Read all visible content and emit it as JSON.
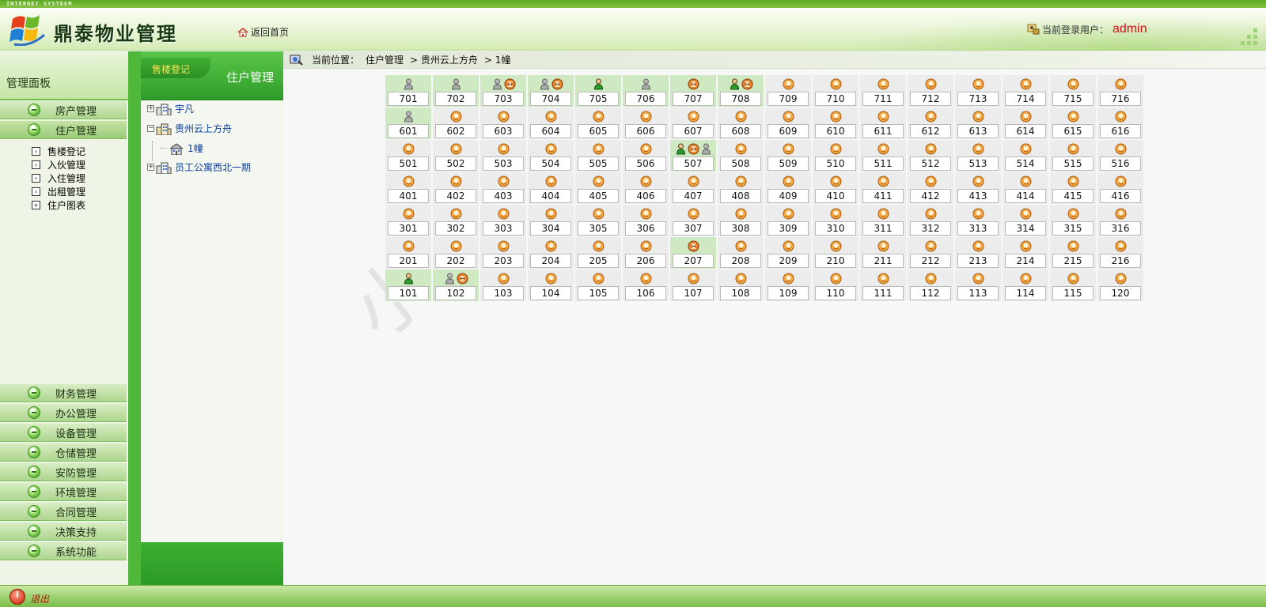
{
  "top_strip": "INTERNET SYSTEEM",
  "header": {
    "app_title": "鼎泰物业管理",
    "home_link": "返回首页",
    "user_label": "当前登录用户：",
    "user_name": "admin"
  },
  "left_panel": {
    "title": "管理面板",
    "top_menu": [
      {
        "label": "房产管理",
        "icon": "green-ball-icon"
      },
      {
        "label": "住户管理",
        "icon": "green-ball-icon",
        "active": true
      }
    ],
    "submenu": [
      {
        "label": "售楼登记",
        "icon": "arrow-box-icon"
      },
      {
        "label": "入伙管理",
        "icon": "arrow-box-icon"
      },
      {
        "label": "入住管理",
        "icon": "arrow-box-icon"
      },
      {
        "label": "出租管理",
        "icon": "arrow-box-icon"
      },
      {
        "label": "住户图表",
        "icon": "double-arrow-box-icon"
      }
    ],
    "bottom_menu": [
      {
        "label": "财务管理"
      },
      {
        "label": "办公管理"
      },
      {
        "label": "设备管理"
      },
      {
        "label": "仓储管理"
      },
      {
        "label": "安防管理"
      },
      {
        "label": "环境管理"
      },
      {
        "label": "合同管理"
      },
      {
        "label": "决策支持"
      },
      {
        "label": "系统功能"
      }
    ],
    "logout": "退出"
  },
  "tree_panel": {
    "tab": "售楼登记",
    "title": "住户管理",
    "nodes": [
      {
        "label": "宇凡",
        "expander": "+"
      },
      {
        "label": "贵州云上方舟",
        "expander": "-"
      },
      {
        "label": "1幢",
        "expander": ""
      },
      {
        "label": "员工公寓西北一期",
        "expander": "+"
      }
    ]
  },
  "breadcrumb": {
    "prefix": "当前位置：",
    "items": [
      "住户管理",
      "> 贵州云上方舟",
      "> 1幢"
    ]
  },
  "watermark": "小小源码",
  "colors": {
    "brand_green": "#4fb83a",
    "occupied_cell": "#cfeac2",
    "vacant_cell": "#ececec",
    "user_name": "#d6101a"
  },
  "icon_legend": {
    "V": "vacant-face-icon",
    "G": "gray-person-icon",
    "P": "green-person-icon",
    "R": "rent-badge-icon"
  },
  "rooms": [
    [
      {
        "n": "701",
        "i": "G",
        "o": true
      },
      {
        "n": "702",
        "i": "G",
        "o": true
      },
      {
        "n": "703",
        "i": "GR",
        "o": true
      },
      {
        "n": "704",
        "i": "GR",
        "o": true
      },
      {
        "n": "705",
        "i": "P",
        "o": true
      },
      {
        "n": "706",
        "i": "G",
        "o": true
      },
      {
        "n": "707",
        "i": "R",
        "o": true
      },
      {
        "n": "708",
        "i": "PR",
        "o": true
      },
      {
        "n": "709",
        "i": "V"
      },
      {
        "n": "710",
        "i": "V"
      },
      {
        "n": "711",
        "i": "V"
      },
      {
        "n": "712",
        "i": "V"
      },
      {
        "n": "713",
        "i": "V"
      },
      {
        "n": "714",
        "i": "V"
      },
      {
        "n": "715",
        "i": "V"
      },
      {
        "n": "716",
        "i": "V"
      }
    ],
    [
      {
        "n": "601",
        "i": "G",
        "o": true
      },
      {
        "n": "602",
        "i": "V"
      },
      {
        "n": "603",
        "i": "V"
      },
      {
        "n": "604",
        "i": "V"
      },
      {
        "n": "605",
        "i": "V"
      },
      {
        "n": "606",
        "i": "V"
      },
      {
        "n": "607",
        "i": "V"
      },
      {
        "n": "608",
        "i": "V"
      },
      {
        "n": "609",
        "i": "V"
      },
      {
        "n": "610",
        "i": "V"
      },
      {
        "n": "611",
        "i": "V"
      },
      {
        "n": "612",
        "i": "V"
      },
      {
        "n": "613",
        "i": "V"
      },
      {
        "n": "614",
        "i": "V"
      },
      {
        "n": "615",
        "i": "V"
      },
      {
        "n": "616",
        "i": "V"
      }
    ],
    [
      {
        "n": "501",
        "i": "V"
      },
      {
        "n": "502",
        "i": "V"
      },
      {
        "n": "503",
        "i": "V"
      },
      {
        "n": "504",
        "i": "V"
      },
      {
        "n": "505",
        "i": "V"
      },
      {
        "n": "506",
        "i": "V"
      },
      {
        "n": "507",
        "i": "PRG",
        "o": true
      },
      {
        "n": "508",
        "i": "V"
      },
      {
        "n": "509",
        "i": "V"
      },
      {
        "n": "510",
        "i": "V"
      },
      {
        "n": "511",
        "i": "V"
      },
      {
        "n": "512",
        "i": "V"
      },
      {
        "n": "513",
        "i": "V"
      },
      {
        "n": "514",
        "i": "V"
      },
      {
        "n": "515",
        "i": "V"
      },
      {
        "n": "516",
        "i": "V"
      }
    ],
    [
      {
        "n": "401",
        "i": "V"
      },
      {
        "n": "402",
        "i": "V"
      },
      {
        "n": "403",
        "i": "V"
      },
      {
        "n": "404",
        "i": "V"
      },
      {
        "n": "405",
        "i": "V"
      },
      {
        "n": "406",
        "i": "V"
      },
      {
        "n": "407",
        "i": "V"
      },
      {
        "n": "408",
        "i": "V"
      },
      {
        "n": "409",
        "i": "V"
      },
      {
        "n": "410",
        "i": "V"
      },
      {
        "n": "411",
        "i": "V"
      },
      {
        "n": "412",
        "i": "V"
      },
      {
        "n": "413",
        "i": "V"
      },
      {
        "n": "414",
        "i": "V"
      },
      {
        "n": "415",
        "i": "V"
      },
      {
        "n": "416",
        "i": "V"
      }
    ],
    [
      {
        "n": "301",
        "i": "V"
      },
      {
        "n": "302",
        "i": "V"
      },
      {
        "n": "303",
        "i": "V"
      },
      {
        "n": "304",
        "i": "V"
      },
      {
        "n": "305",
        "i": "V"
      },
      {
        "n": "306",
        "i": "V"
      },
      {
        "n": "307",
        "i": "V"
      },
      {
        "n": "308",
        "i": "V"
      },
      {
        "n": "309",
        "i": "V"
      },
      {
        "n": "310",
        "i": "V"
      },
      {
        "n": "311",
        "i": "V"
      },
      {
        "n": "312",
        "i": "V"
      },
      {
        "n": "313",
        "i": "V"
      },
      {
        "n": "314",
        "i": "V"
      },
      {
        "n": "315",
        "i": "V"
      },
      {
        "n": "316",
        "i": "V"
      }
    ],
    [
      {
        "n": "201",
        "i": "V"
      },
      {
        "n": "202",
        "i": "V"
      },
      {
        "n": "203",
        "i": "V"
      },
      {
        "n": "204",
        "i": "V"
      },
      {
        "n": "205",
        "i": "V"
      },
      {
        "n": "206",
        "i": "V"
      },
      {
        "n": "207",
        "i": "R",
        "o": true
      },
      {
        "n": "208",
        "i": "V"
      },
      {
        "n": "209",
        "i": "V"
      },
      {
        "n": "210",
        "i": "V"
      },
      {
        "n": "211",
        "i": "V"
      },
      {
        "n": "212",
        "i": "V"
      },
      {
        "n": "213",
        "i": "V"
      },
      {
        "n": "214",
        "i": "V"
      },
      {
        "n": "215",
        "i": "V"
      },
      {
        "n": "216",
        "i": "V"
      }
    ],
    [
      {
        "n": "101",
        "i": "P",
        "o": true
      },
      {
        "n": "102",
        "i": "GR",
        "o": true
      },
      {
        "n": "103",
        "i": "V"
      },
      {
        "n": "104",
        "i": "V"
      },
      {
        "n": "105",
        "i": "V"
      },
      {
        "n": "106",
        "i": "V"
      },
      {
        "n": "107",
        "i": "V"
      },
      {
        "n": "108",
        "i": "V"
      },
      {
        "n": "109",
        "i": "V"
      },
      {
        "n": "110",
        "i": "V"
      },
      {
        "n": "111",
        "i": "V"
      },
      {
        "n": "112",
        "i": "V"
      },
      {
        "n": "113",
        "i": "V"
      },
      {
        "n": "114",
        "i": "V"
      },
      {
        "n": "115",
        "i": "V"
      },
      {
        "n": "120",
        "i": "V"
      }
    ]
  ]
}
